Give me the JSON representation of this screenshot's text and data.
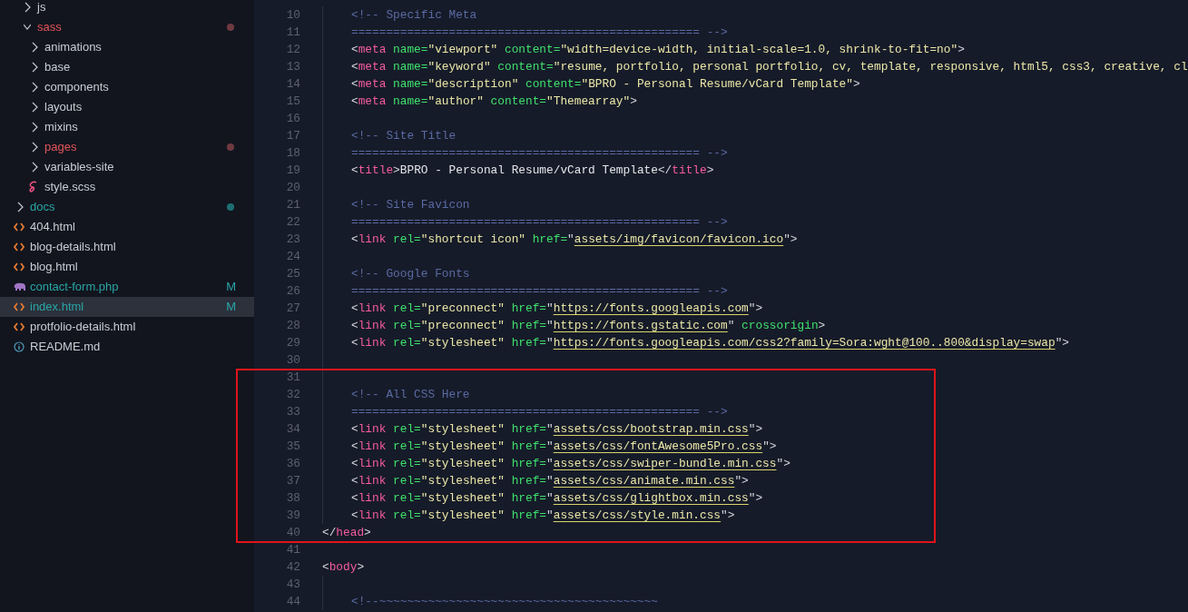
{
  "explorer": {
    "items": [
      {
        "children": [
          {
            "name": "js",
            "kind": "folder",
            "expanded": false,
            "selected": false
          },
          {
            "name": "sass",
            "kind": "folder",
            "expanded": true,
            "selected": false,
            "error": true,
            "children": [
              {
                "name": "animations",
                "kind": "folder",
                "expanded": false,
                "selected": false
              },
              {
                "name": "base",
                "kind": "folder",
                "expanded": false,
                "selected": false
              },
              {
                "name": "components",
                "kind": "folder",
                "expanded": false,
                "selected": false
              },
              {
                "name": "layouts",
                "kind": "folder",
                "expanded": false,
                "selected": false
              },
              {
                "name": "mixins",
                "kind": "folder",
                "expanded": false,
                "selected": false
              },
              {
                "name": "pages",
                "kind": "folder",
                "expanded": false,
                "selected": false,
                "error": true
              },
              {
                "name": "variables-site",
                "kind": "folder",
                "expanded": false,
                "selected": false
              },
              {
                "name": "style.scss",
                "kind": "scss",
                "selected": false
              }
            ]
          }
        ]
      },
      {
        "name": "docs",
        "kind": "folder",
        "expanded": false,
        "selected": false,
        "changed": true
      },
      {
        "name": "404.html",
        "kind": "html",
        "selected": false
      },
      {
        "name": "blog-details.html",
        "kind": "html",
        "selected": false
      },
      {
        "name": "blog.html",
        "kind": "html",
        "selected": false
      },
      {
        "name": "contact-form.php",
        "kind": "php",
        "selected": false,
        "changed": true,
        "badge": "M"
      },
      {
        "name": "index.html",
        "kind": "html",
        "selected": true,
        "changed": true,
        "badge": "M"
      },
      {
        "name": "protfolio-details.html",
        "kind": "html",
        "selected": false
      },
      {
        "name": "README.md",
        "kind": "info",
        "selected": false
      }
    ]
  },
  "editor": {
    "lines": [
      {
        "number": "10",
        "indented": true,
        "code": [
          {
            "kind": "comment",
            "text": "<!-- Specific Meta"
          }
        ]
      },
      {
        "number": "11",
        "indented": true,
        "code": [
          {
            "kind": "comment",
            "text": "================================================== -->"
          }
        ]
      },
      {
        "number": "12",
        "indented": true,
        "code": [
          {
            "kind": "punct",
            "text": "<"
          },
          {
            "kind": "tag",
            "text": "meta"
          },
          {
            "kind": "attr",
            "text": " name="
          },
          {
            "kind": "string",
            "text": "\"viewport\""
          },
          {
            "kind": "attr",
            "text": " content="
          },
          {
            "kind": "string",
            "text": "\"width=device-width, initial-scale=1.0, shrink-to-fit=no\""
          },
          {
            "kind": "punct",
            "text": ">"
          }
        ]
      },
      {
        "number": "13",
        "indented": true,
        "code": [
          {
            "kind": "punct",
            "text": "<"
          },
          {
            "kind": "tag",
            "text": "meta"
          },
          {
            "kind": "attr",
            "text": " name="
          },
          {
            "kind": "string",
            "text": "\"keyword\""
          },
          {
            "kind": "attr",
            "text": " content="
          },
          {
            "kind": "string",
            "text": "\"resume, portfolio, personal portfolio, cv, template, responsive, html5, css3, creative, cl"
          }
        ]
      },
      {
        "number": "14",
        "indented": true,
        "code": [
          {
            "kind": "punct",
            "text": "<"
          },
          {
            "kind": "tag",
            "text": "meta"
          },
          {
            "kind": "attr",
            "text": " name="
          },
          {
            "kind": "string",
            "text": "\"description\""
          },
          {
            "kind": "attr",
            "text": " content="
          },
          {
            "kind": "string",
            "text": "\"BPRO - Personal Resume/vCard Template\""
          },
          {
            "kind": "punct",
            "text": ">"
          }
        ]
      },
      {
        "number": "15",
        "indented": true,
        "code": [
          {
            "kind": "punct",
            "text": "<"
          },
          {
            "kind": "tag",
            "text": "meta"
          },
          {
            "kind": "attr",
            "text": " name="
          },
          {
            "kind": "string",
            "text": "\"author\""
          },
          {
            "kind": "attr",
            "text": " content="
          },
          {
            "kind": "string",
            "text": "\"Themearray\""
          },
          {
            "kind": "punct",
            "text": ">"
          }
        ]
      },
      {
        "number": "16",
        "indented": true
      },
      {
        "number": "17",
        "indented": true,
        "code": [
          {
            "kind": "comment",
            "text": "<!-- Site Title"
          }
        ]
      },
      {
        "number": "18",
        "indented": true,
        "code": [
          {
            "kind": "comment",
            "text": "================================================== -->"
          }
        ]
      },
      {
        "number": "19",
        "indented": true,
        "code": [
          {
            "kind": "punct",
            "text": "<"
          },
          {
            "kind": "tag",
            "text": "title"
          },
          {
            "kind": "punct",
            "text": ">"
          },
          {
            "kind": "text",
            "text": "BPRO - Personal Resume/vCard Template"
          },
          {
            "kind": "punct",
            "text": "</"
          },
          {
            "kind": "tag",
            "text": "title"
          },
          {
            "kind": "punct",
            "text": ">"
          }
        ]
      },
      {
        "number": "20",
        "indented": true
      },
      {
        "number": "21",
        "indented": true,
        "code": [
          {
            "kind": "comment",
            "text": "<!-- Site Favicon"
          }
        ]
      },
      {
        "number": "22",
        "indented": true,
        "code": [
          {
            "kind": "comment",
            "text": "================================================== -->"
          }
        ]
      },
      {
        "number": "23",
        "indented": true,
        "code": [
          {
            "kind": "punct",
            "text": "<"
          },
          {
            "kind": "tag",
            "text": "link"
          },
          {
            "kind": "attr",
            "text": " rel="
          },
          {
            "kind": "string",
            "text": "\"shortcut icon\""
          },
          {
            "kind": "attr",
            "text": " href="
          },
          {
            "kind": "punct",
            "text": "\""
          },
          {
            "kind": "link",
            "text": "assets/img/favicon/favicon.ico"
          },
          {
            "kind": "punct",
            "text": "\">"
          }
        ]
      },
      {
        "number": "24",
        "indented": true
      },
      {
        "number": "25",
        "indented": true,
        "code": [
          {
            "kind": "comment",
            "text": "<!-- Google Fonts"
          }
        ]
      },
      {
        "number": "26",
        "indented": true,
        "code": [
          {
            "kind": "comment",
            "text": "================================================== -->"
          }
        ]
      },
      {
        "number": "27",
        "indented": true,
        "code": [
          {
            "kind": "punct",
            "text": "<"
          },
          {
            "kind": "tag",
            "text": "link"
          },
          {
            "kind": "attr",
            "text": " rel="
          },
          {
            "kind": "string",
            "text": "\"preconnect\""
          },
          {
            "kind": "attr",
            "text": " href="
          },
          {
            "kind": "punct",
            "text": "\""
          },
          {
            "kind": "link",
            "text": "https://fonts.googleapis.com"
          },
          {
            "kind": "punct",
            "text": "\">"
          }
        ]
      },
      {
        "number": "28",
        "indented": true,
        "code": [
          {
            "kind": "punct",
            "text": "<"
          },
          {
            "kind": "tag",
            "text": "link"
          },
          {
            "kind": "attr",
            "text": " rel="
          },
          {
            "kind": "string",
            "text": "\"preconnect\""
          },
          {
            "kind": "attr",
            "text": " href="
          },
          {
            "kind": "punct",
            "text": "\""
          },
          {
            "kind": "link",
            "text": "https://fonts.gstatic.com"
          },
          {
            "kind": "punct",
            "text": "\""
          },
          {
            "kind": "attr",
            "text": " crossorigin"
          },
          {
            "kind": "punct",
            "text": ">"
          }
        ]
      },
      {
        "number": "29",
        "indented": true,
        "code": [
          {
            "kind": "punct",
            "text": "<"
          },
          {
            "kind": "tag",
            "text": "link"
          },
          {
            "kind": "attr",
            "text": " rel="
          },
          {
            "kind": "string",
            "text": "\"stylesheet\""
          },
          {
            "kind": "attr",
            "text": " href="
          },
          {
            "kind": "punct",
            "text": "\""
          },
          {
            "kind": "link",
            "text": "https://fonts.googleapis.com/css2?family=Sora:wght@100..800&display=swap"
          },
          {
            "kind": "punct",
            "text": "\">"
          }
        ]
      },
      {
        "number": "30",
        "indented": true
      },
      {
        "number": "31",
        "indented": true
      },
      {
        "number": "32",
        "indented": true,
        "code": [
          {
            "kind": "comment",
            "text": "<!-- All CSS Here"
          }
        ]
      },
      {
        "number": "33",
        "indented": true,
        "code": [
          {
            "kind": "comment",
            "text": "================================================== -->"
          }
        ]
      },
      {
        "number": "34",
        "indented": true,
        "code": [
          {
            "kind": "punct",
            "text": "<"
          },
          {
            "kind": "tag",
            "text": "link"
          },
          {
            "kind": "attr",
            "text": " rel="
          },
          {
            "kind": "string",
            "text": "\"stylesheet\""
          },
          {
            "kind": "attr",
            "text": " href="
          },
          {
            "kind": "punct",
            "text": "\""
          },
          {
            "kind": "link",
            "text": "assets/css/bootstrap.min.css"
          },
          {
            "kind": "punct",
            "text": "\">"
          }
        ]
      },
      {
        "number": "35",
        "indented": true,
        "code": [
          {
            "kind": "punct",
            "text": "<"
          },
          {
            "kind": "tag",
            "text": "link"
          },
          {
            "kind": "attr",
            "text": " rel="
          },
          {
            "kind": "string",
            "text": "\"stylesheet\""
          },
          {
            "kind": "attr",
            "text": " href="
          },
          {
            "kind": "punct",
            "text": "\""
          },
          {
            "kind": "link",
            "text": "assets/css/fontAwesome5Pro.css"
          },
          {
            "kind": "punct",
            "text": "\">"
          }
        ]
      },
      {
        "number": "36",
        "indented": true,
        "code": [
          {
            "kind": "punct",
            "text": "<"
          },
          {
            "kind": "tag",
            "text": "link"
          },
          {
            "kind": "attr",
            "text": " rel="
          },
          {
            "kind": "string",
            "text": "\"stylesheet\""
          },
          {
            "kind": "attr",
            "text": " href="
          },
          {
            "kind": "punct",
            "text": "\""
          },
          {
            "kind": "link",
            "text": "assets/css/swiper-bundle.min.css"
          },
          {
            "kind": "punct",
            "text": "\">"
          }
        ]
      },
      {
        "number": "37",
        "indented": true,
        "code": [
          {
            "kind": "punct",
            "text": "<"
          },
          {
            "kind": "tag",
            "text": "link"
          },
          {
            "kind": "attr",
            "text": " rel="
          },
          {
            "kind": "string",
            "text": "\"stylesheet\""
          },
          {
            "kind": "attr",
            "text": " href="
          },
          {
            "kind": "punct",
            "text": "\""
          },
          {
            "kind": "link",
            "text": "assets/css/animate.min.css"
          },
          {
            "kind": "punct",
            "text": "\">"
          }
        ]
      },
      {
        "number": "38",
        "indented": true,
        "code": [
          {
            "kind": "punct",
            "text": "<"
          },
          {
            "kind": "tag",
            "text": "link"
          },
          {
            "kind": "attr",
            "text": " rel="
          },
          {
            "kind": "string",
            "text": "\"stylesheet\""
          },
          {
            "kind": "attr",
            "text": " href="
          },
          {
            "kind": "punct",
            "text": "\""
          },
          {
            "kind": "link",
            "text": "assets/css/glightbox.min.css"
          },
          {
            "kind": "punct",
            "text": "\">"
          }
        ]
      },
      {
        "number": "39",
        "indented": true,
        "code": [
          {
            "kind": "punct",
            "text": "<"
          },
          {
            "kind": "tag",
            "text": "link"
          },
          {
            "kind": "attr",
            "text": " rel="
          },
          {
            "kind": "string",
            "text": "\"stylesheet\""
          },
          {
            "kind": "attr",
            "text": " href="
          },
          {
            "kind": "punct",
            "text": "\""
          },
          {
            "kind": "link",
            "text": "assets/css/style.min.css"
          },
          {
            "kind": "punct",
            "text": "\">"
          }
        ]
      },
      {
        "number": "40",
        "indented": false,
        "code": [
          {
            "kind": "punct",
            "text": "</"
          },
          {
            "kind": "tag",
            "text": "head"
          },
          {
            "kind": "punct",
            "text": ">"
          }
        ]
      },
      {
        "number": "41",
        "indented": false
      },
      {
        "number": "42",
        "indented": false,
        "code": [
          {
            "kind": "punct",
            "text": "<"
          },
          {
            "kind": "tag",
            "text": "body"
          },
          {
            "kind": "punct",
            "text": ">"
          }
        ]
      },
      {
        "number": "43",
        "indented": true
      },
      {
        "number": "44",
        "indented": true,
        "code": [
          {
            "kind": "comment",
            "text": "<!--~~~~~~~~~~~~~~~~~~~~~~~~~~~~~~~~~~~~~~~~"
          }
        ]
      }
    ]
  }
}
